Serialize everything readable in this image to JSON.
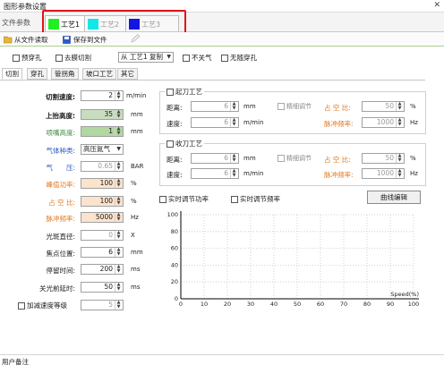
{
  "window": {
    "title": "图形参数设置",
    "close": "✕"
  },
  "file_tab": {
    "label": "文件参数"
  },
  "process_tabs": [
    {
      "label": "工艺1",
      "color": "#22ee22",
      "active": true
    },
    {
      "label": "工艺2",
      "color": "#11e8e8",
      "active": false
    },
    {
      "label": "工艺3",
      "color": "#1515e0",
      "active": false
    }
  ],
  "toolbar": {
    "load_label": "从文件读取",
    "save_label": "保存到文件"
  },
  "options": {
    "pre_pierce": "预穿孔",
    "film_cut": "去膜切割",
    "copy_from_value": "从 工艺1 复制",
    "gas_off": "不关气",
    "no_lead_pierce": "无随穿孔"
  },
  "subtabs": [
    "切割",
    "穿孔",
    "管拐角",
    "坡口工艺",
    "其它"
  ],
  "left_params": {
    "cut_speed": {
      "label": "切割速度:",
      "value": "2",
      "unit": "m/min"
    },
    "lift_height": {
      "label": "上抬高度:",
      "value": "35",
      "unit": "mm"
    },
    "nozzle_height": {
      "label": "喷嘴高度:",
      "value": "1",
      "unit": "mm"
    },
    "gas_type": {
      "label": "气体种类:",
      "value": "高压氮气"
    },
    "gas_pressure": {
      "label": "气　　压:",
      "value": "0.65",
      "unit": "BAR"
    },
    "peak_power": {
      "label": "峰值功率:",
      "value": "100",
      "unit": "%"
    },
    "duty_ratio": {
      "label": "占 空 比:",
      "value": "100",
      "unit": "%"
    },
    "pulse_freq": {
      "label": "脉冲频率:",
      "value": "5000",
      "unit": "Hz"
    },
    "spot_diameter": {
      "label": "光斑直径:",
      "value": "0",
      "unit": "X"
    },
    "focus_position": {
      "label": "焦点位置:",
      "value": "6",
      "unit": "mm"
    },
    "stop_delay": {
      "label": "停留时间:",
      "value": "200",
      "unit": "ms"
    },
    "laser_off_delay": {
      "label": "关光前延时:",
      "value": "50",
      "unit": "ms"
    },
    "accel_level": {
      "label": "加减速度等级",
      "value": "5"
    }
  },
  "start_process": {
    "title": "起刀工艺",
    "distance_label": "距离:",
    "distance_value": "6",
    "distance_unit": "mm",
    "speed_label": "速度:",
    "speed_value": "6",
    "speed_unit": "m/min",
    "fine_adjust": "精细调节",
    "duty_label": "占 空 比:",
    "duty_value": "50",
    "duty_unit": "%",
    "freq_label": "脉冲频率:",
    "freq_value": "1000",
    "freq_unit": "Hz"
  },
  "end_process": {
    "title": "收刀工艺",
    "distance_label": "距离:",
    "distance_value": "6",
    "distance_unit": "mm",
    "speed_label": "速度:",
    "speed_value": "6",
    "speed_unit": "m/min",
    "fine_adjust": "精细调节",
    "duty_label": "占 空 比:",
    "duty_value": "50",
    "duty_unit": "%",
    "freq_label": "脉冲频率:",
    "freq_value": "1000",
    "freq_unit": "Hz"
  },
  "realtime": {
    "power_label": "实时调节功率",
    "freq_label": "实时调节频率",
    "edit_button": "曲线编辑"
  },
  "chart": {
    "y_ticks": [
      "100",
      "80",
      "60",
      "40",
      "20",
      "0"
    ],
    "x_ticks": [
      "0",
      "10",
      "20",
      "30",
      "40",
      "50",
      "60",
      "70",
      "80",
      "90",
      "100"
    ],
    "x_label": "Speed(%)"
  },
  "footer": {
    "label": "用户备注"
  }
}
